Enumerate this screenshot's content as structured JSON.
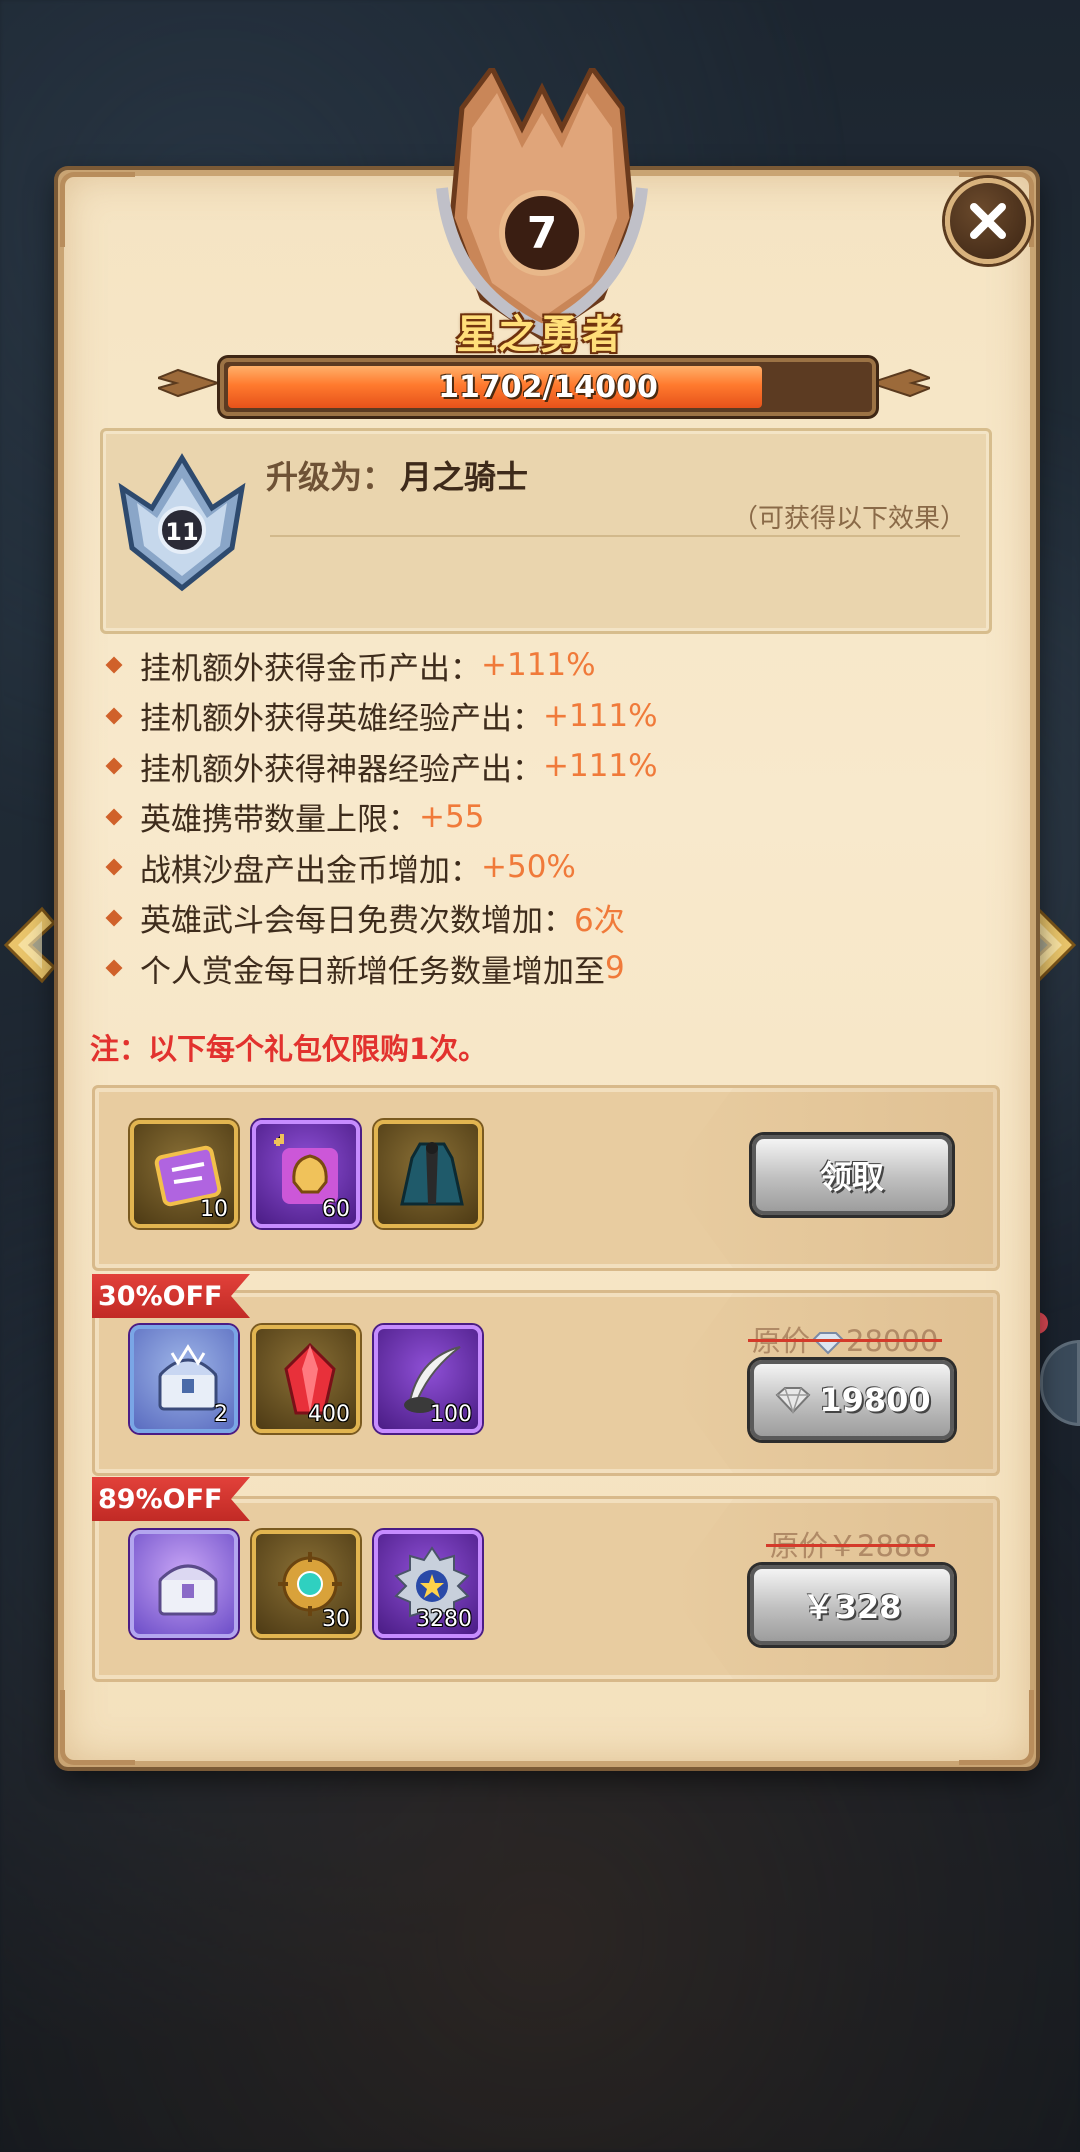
{
  "rank": {
    "level": "7",
    "title": "星之勇者",
    "progress_text": "11702/14000",
    "progress_fraction": 0.836
  },
  "upgrade": {
    "badge_level": "11",
    "label": "升级为：",
    "target": "月之骑士",
    "note": "（可获得以下效果）"
  },
  "effects": [
    {
      "text": "挂机额外获得金币产出：",
      "value": "+111%"
    },
    {
      "text": "挂机额外获得英雄经验产出：",
      "value": "+111%"
    },
    {
      "text": "挂机额外获得神器经验产出：",
      "value": "+111%"
    },
    {
      "text": "英雄携带数量上限：",
      "value": "+55"
    },
    {
      "text": "战棋沙盘产出金币增加：",
      "value": "+50%"
    },
    {
      "text": "英雄武斗会每日免费次数增加：",
      "value": "6次"
    },
    {
      "text": "个人赏金每日新增任务数量增加至",
      "value": "9"
    }
  ],
  "note": "注：以下每个礼包仅限购1次。",
  "packs": [
    {
      "items": [
        {
          "icon": "scroll-icon",
          "count": "10"
        },
        {
          "icon": "helmet-fragment-icon",
          "count": "60"
        },
        {
          "icon": "hero-costume-icon",
          "count": ""
        }
      ],
      "button": "领取"
    },
    {
      "tag": "30%OFF",
      "items": [
        {
          "icon": "treasure-chest-icon",
          "count": "2"
        },
        {
          "icon": "red-crystal-icon",
          "count": "400"
        },
        {
          "icon": "quill-icon",
          "count": "100"
        }
      ],
      "original_label": "原价",
      "original_price": "28000",
      "price": "19800"
    },
    {
      "tag": "89%OFF",
      "items": [
        {
          "icon": "silver-chest-icon",
          "count": ""
        },
        {
          "icon": "gold-compass-icon",
          "count": "30"
        },
        {
          "icon": "star-medal-icon",
          "count": "3280"
        }
      ],
      "original_price": "原价￥2888",
      "price": "￥328"
    }
  ],
  "colors": {
    "accent": "#f07a3a",
    "note_red": "#e2322e",
    "tag_red": "#d03530",
    "panel": "#f6e6c6"
  }
}
